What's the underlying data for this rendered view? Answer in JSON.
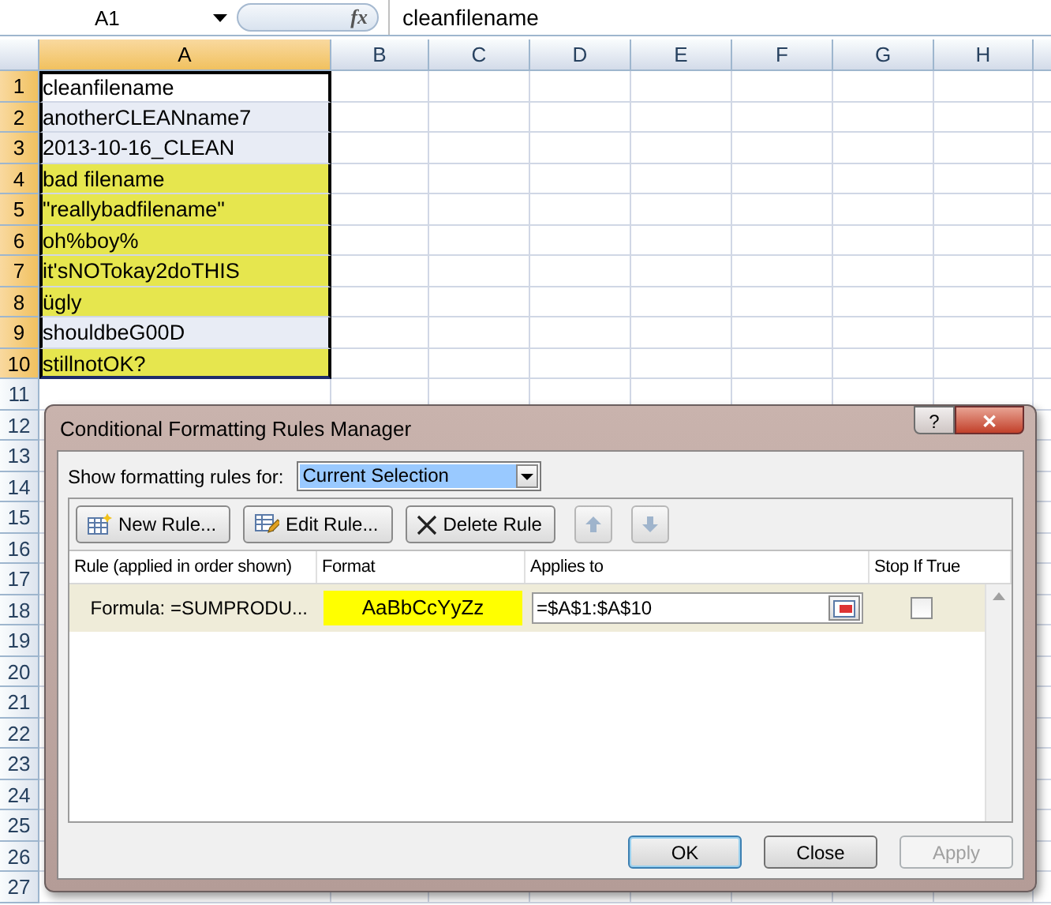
{
  "formula_bar": {
    "name_box": "A1",
    "fx": "fx",
    "formula": "cleanfilename"
  },
  "columns": [
    {
      "label": "A",
      "selected": true
    },
    {
      "label": "B",
      "selected": false
    },
    {
      "label": "C",
      "selected": false
    },
    {
      "label": "D",
      "selected": false
    },
    {
      "label": "E",
      "selected": false
    },
    {
      "label": "F",
      "selected": false
    },
    {
      "label": "G",
      "selected": false
    },
    {
      "label": "H",
      "selected": false
    }
  ],
  "rows": [
    {
      "number": "1",
      "selected": true,
      "cell": {
        "text": "cleanfilename",
        "active": true,
        "highlighted": false
      }
    },
    {
      "number": "2",
      "selected": true,
      "cell": {
        "text": "anotherCLEANname7",
        "active": false,
        "highlighted": false
      }
    },
    {
      "number": "3",
      "selected": true,
      "cell": {
        "text": "2013-10-16_CLEAN",
        "active": false,
        "highlighted": false
      }
    },
    {
      "number": "4",
      "selected": true,
      "cell": {
        "text": "bad filename",
        "active": false,
        "highlighted": true
      }
    },
    {
      "number": "5",
      "selected": true,
      "cell": {
        "text": "\"reallybadfilename\"",
        "active": false,
        "highlighted": true
      }
    },
    {
      "number": "6",
      "selected": true,
      "cell": {
        "text": "oh%boy%",
        "active": false,
        "highlighted": true
      }
    },
    {
      "number": "7",
      "selected": true,
      "cell": {
        "text": "it'sNOTokay2doTHIS",
        "active": false,
        "highlighted": true
      }
    },
    {
      "number": "8",
      "selected": true,
      "cell": {
        "text": "ügly",
        "active": false,
        "highlighted": true
      }
    },
    {
      "number": "9",
      "selected": true,
      "cell": {
        "text": "shouldbeG00D",
        "active": false,
        "highlighted": false
      }
    },
    {
      "number": "10",
      "selected": true,
      "cell": {
        "text": "stillnotOK?",
        "active": false,
        "highlighted": true
      }
    },
    {
      "number": "11",
      "selected": false
    },
    {
      "number": "12",
      "selected": false
    },
    {
      "number": "13",
      "selected": false
    },
    {
      "number": "14",
      "selected": false
    },
    {
      "number": "15",
      "selected": false
    },
    {
      "number": "16",
      "selected": false
    },
    {
      "number": "17",
      "selected": false
    },
    {
      "number": "18",
      "selected": false
    },
    {
      "number": "19",
      "selected": false
    },
    {
      "number": "20",
      "selected": false
    },
    {
      "number": "21",
      "selected": false
    },
    {
      "number": "22",
      "selected": false
    },
    {
      "number": "23",
      "selected": false
    },
    {
      "number": "24",
      "selected": false
    },
    {
      "number": "25",
      "selected": false
    },
    {
      "number": "26",
      "selected": false
    },
    {
      "number": "27",
      "selected": false
    }
  ],
  "dialog": {
    "title": "Conditional Formatting Rules Manager",
    "help": "?",
    "close": "✕",
    "show_label": "Show formatting rules for:",
    "show_value": "Current Selection",
    "toolbar": [
      {
        "kind": "new",
        "label": "New Rule..."
      },
      {
        "kind": "edit",
        "label": "Edit Rule..."
      },
      {
        "kind": "delete",
        "label": "Delete Rule"
      },
      {
        "kind": "up"
      },
      {
        "kind": "down"
      }
    ],
    "columns": [
      "Rule (applied in order shown)",
      "Format",
      "Applies to",
      "Stop If True"
    ],
    "rules": [
      {
        "rule": "Formula: =SUMPRODU...",
        "format_sample": "AaBbCcYyZz",
        "color": "#ffff00",
        "applies_to": "=$A$1:$A$10",
        "stop_if_true": false,
        "selected": true
      }
    ],
    "buttons": [
      {
        "label": "OK",
        "default": true,
        "disabled": false
      },
      {
        "label": "Close",
        "default": false,
        "disabled": false
      },
      {
        "label": "Apply",
        "default": false,
        "disabled": true
      }
    ]
  }
}
